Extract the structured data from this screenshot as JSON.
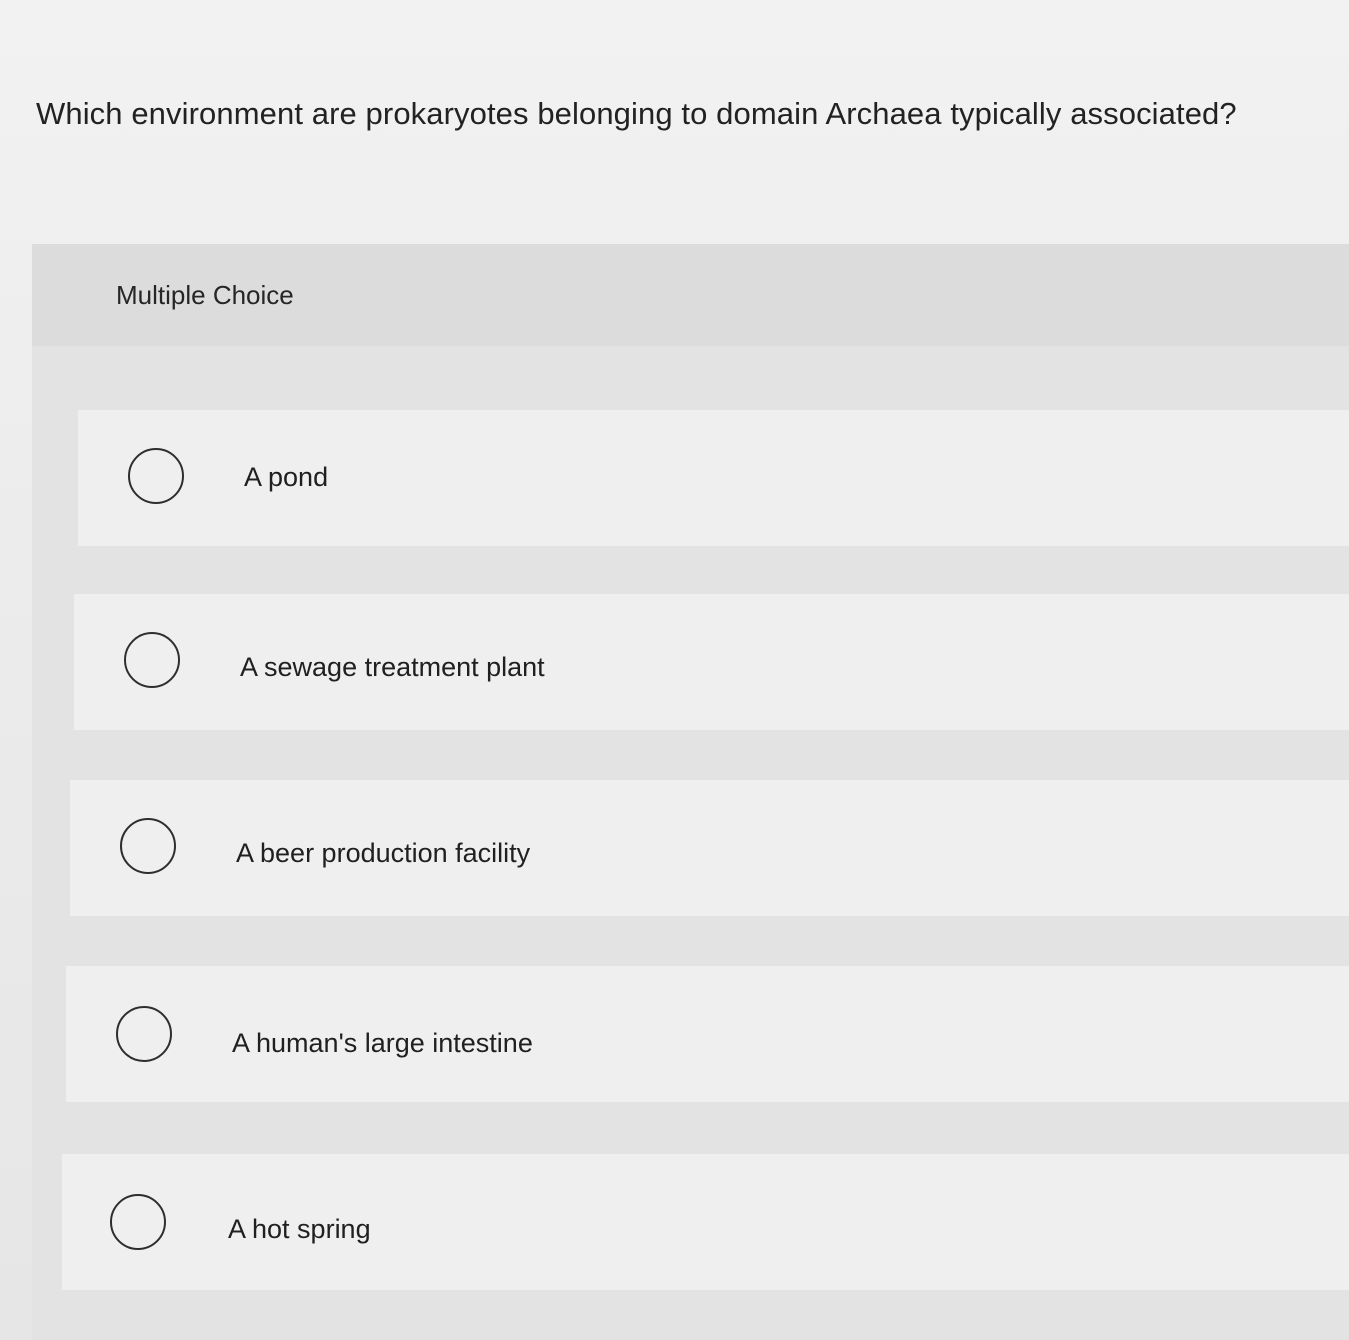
{
  "question": {
    "text": "Which environment are prokaryotes belonging to domain Archaea typically associated?"
  },
  "panel": {
    "title": "Multiple Choice"
  },
  "options": [
    {
      "label": "A pond",
      "selected": false
    },
    {
      "label": "A sewage treatment plant",
      "selected": false
    },
    {
      "label": "A beer production facility",
      "selected": false
    },
    {
      "label": "A human's large intestine",
      "selected": false
    },
    {
      "label": "A hot spring",
      "selected": false
    }
  ]
}
